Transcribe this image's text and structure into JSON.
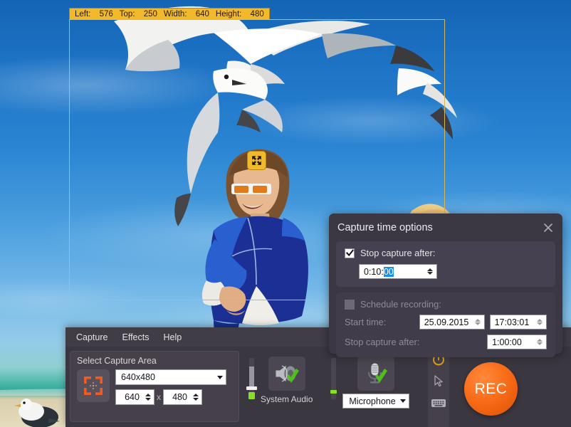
{
  "desktop": {
    "wallpaper_description": "beach scene with seagulls, blue sky, man in blue rash guard with sunglasses"
  },
  "selection": {
    "info_fields": [
      {
        "label": "Left:",
        "value": "576"
      },
      {
        "label": "Top:",
        "value": "250"
      },
      {
        "label": "Width:",
        "value": "640"
      },
      {
        "label": "Height:",
        "value": "480"
      }
    ],
    "move_handle_icon": "four-way-resize-arrows-icon",
    "border_color": "#d8b45a",
    "info_bg_color": "#f2b92c"
  },
  "app": {
    "menubar": [
      {
        "label": "Capture"
      },
      {
        "label": "Effects"
      },
      {
        "label": "Help"
      }
    ],
    "capture_area": {
      "title": "Select Capture Area",
      "select_icon": "capture-frame-crosshair-icon",
      "preset": "640x480",
      "width_value": "640",
      "separator": "x",
      "height_value": "480"
    },
    "audio": {
      "system_audio": {
        "label": "System Audio",
        "icon": "speaker-icon",
        "enabled_badge": "green-check-icon"
      },
      "microphone": {
        "label": "Microphone",
        "icon": "microphone-icon",
        "enabled_badge": "green-check-icon"
      }
    },
    "toolstrip": [
      {
        "icon": "timer-icon",
        "active": true
      },
      {
        "icon": "mouse-cursor-icon",
        "active": false
      },
      {
        "icon": "keyboard-icon",
        "active": false
      }
    ],
    "record_button": {
      "label": "REC",
      "color": "#f96c18"
    }
  },
  "dialog": {
    "title": "Capture time options",
    "close_icon": "close-icon",
    "stop_capture": {
      "checked": true,
      "label": "Stop capture after:",
      "value_prefix": "0:10:",
      "value_selected": "00"
    },
    "schedule": {
      "checked": false,
      "label": "Schedule recording:",
      "start_time_label": "Start time:",
      "start_date_value": "25.09.2015",
      "start_clock_value": "17:03:01",
      "stop_after_label": "Stop capture after:",
      "stop_after_value": "1:00:00"
    }
  }
}
